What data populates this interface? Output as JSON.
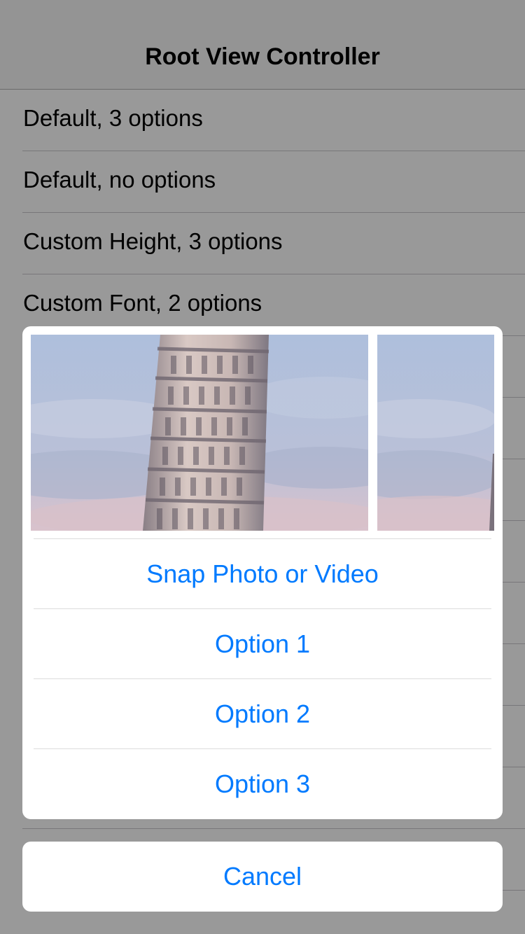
{
  "nav": {
    "title": "Root View Controller"
  },
  "table": {
    "rows": [
      {
        "label": "Default, 3 options"
      },
      {
        "label": "Default, no options"
      },
      {
        "label": "Custom Height, 3 options"
      },
      {
        "label": "Custom Font, 2 options"
      },
      {
        "label": ""
      },
      {
        "label": ""
      },
      {
        "label": ""
      },
      {
        "label": ""
      },
      {
        "label": ""
      },
      {
        "label": ""
      },
      {
        "label": ""
      },
      {
        "label": ""
      },
      {
        "label": ""
      }
    ]
  },
  "action_sheet": {
    "photos": [
      {
        "icon": "leaning-tower-photo"
      },
      {
        "icon": "leaning-tower-photo"
      }
    ],
    "actions": [
      {
        "label": "Snap Photo or Video"
      },
      {
        "label": "Option 1"
      },
      {
        "label": "Option 2"
      },
      {
        "label": "Option 3"
      }
    ],
    "cancel_label": "Cancel",
    "tint_color": "#007aff"
  },
  "colors": {
    "dim_overlay": "rgba(0,0,0,0.4)",
    "sheet_background": "#ffffff"
  }
}
